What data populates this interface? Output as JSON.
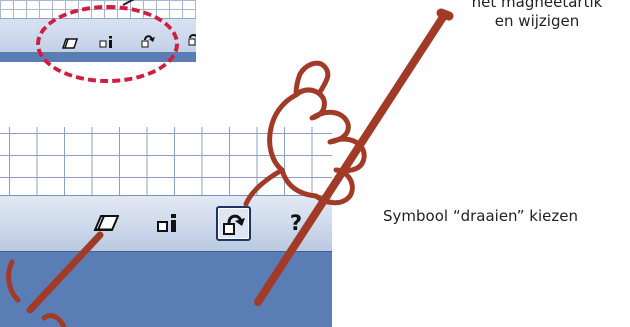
{
  "annotations": {
    "top_right_line1": "het magneetartik",
    "top_right_line2": "en wijzigen",
    "instruction": "Symbool “draaien” kiezen"
  },
  "toolbar": {
    "help_label": "?",
    "selected_tool": "rotate"
  },
  "colors": {
    "toolbar_bg": "#cbd7ea",
    "panel_blue": "#5a7db5",
    "highlight_ellipse": "#d11d3f",
    "pen_stroke": "#a23a28",
    "grid_line": "#8fa0c4"
  },
  "icons": [
    "eraser-icon",
    "info-icon",
    "rotate-icon",
    "help-icon"
  ]
}
